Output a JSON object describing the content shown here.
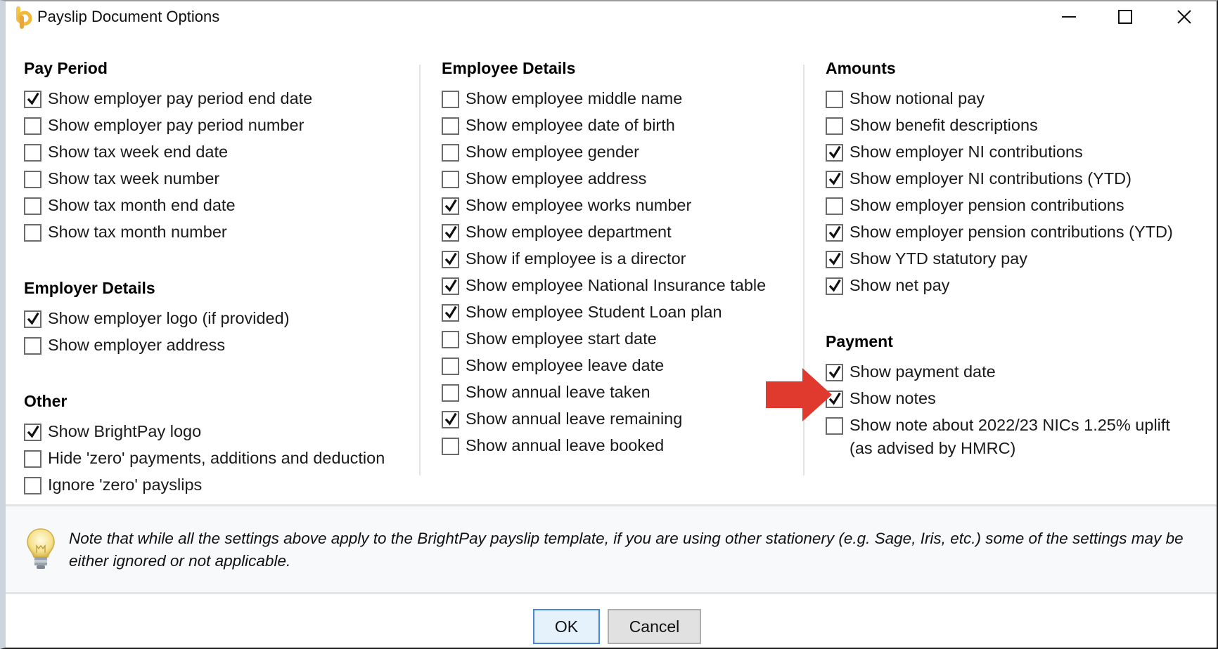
{
  "window": {
    "title": "Payslip Document Options",
    "icons": {
      "app": "brightpay-logo-icon",
      "minimize": "minimize-icon",
      "maximize": "maximize-icon",
      "close": "close-icon"
    }
  },
  "columns": [
    {
      "groups": [
        {
          "heading": "Pay Period",
          "options": [
            {
              "label": "Show employer pay period end date",
              "checked": true
            },
            {
              "label": "Show employer pay period number",
              "checked": false
            },
            {
              "label": "Show tax week end date",
              "checked": false
            },
            {
              "label": "Show tax week number",
              "checked": false
            },
            {
              "label": "Show tax month end date",
              "checked": false
            },
            {
              "label": "Show tax month number",
              "checked": false
            }
          ]
        },
        {
          "heading": "Employer Details",
          "options": [
            {
              "label": "Show employer logo (if provided)",
              "checked": true
            },
            {
              "label": "Show employer address",
              "checked": false
            }
          ]
        },
        {
          "heading": "Other",
          "options": [
            {
              "label": "Show BrightPay logo",
              "checked": true
            },
            {
              "label": "Hide 'zero' payments, additions and deduction",
              "checked": false
            },
            {
              "label": "Ignore 'zero' payslips",
              "checked": false
            }
          ]
        }
      ]
    },
    {
      "groups": [
        {
          "heading": "Employee Details",
          "options": [
            {
              "label": "Show employee middle name",
              "checked": false
            },
            {
              "label": "Show employee date of birth",
              "checked": false
            },
            {
              "label": "Show employee gender",
              "checked": false
            },
            {
              "label": "Show employee address",
              "checked": false
            },
            {
              "label": "Show employee works number",
              "checked": true
            },
            {
              "label": "Show employee department",
              "checked": true
            },
            {
              "label": "Show if employee is a director",
              "checked": true
            },
            {
              "label": "Show employee National Insurance table",
              "checked": true
            },
            {
              "label": "Show employee Student Loan plan",
              "checked": true
            },
            {
              "label": "Show employee start date",
              "checked": false
            },
            {
              "label": "Show employee leave date",
              "checked": false
            },
            {
              "label": "Show annual leave taken",
              "checked": false
            },
            {
              "label": "Show annual leave remaining",
              "checked": true
            },
            {
              "label": "Show annual leave booked",
              "checked": false
            }
          ]
        }
      ]
    },
    {
      "groups": [
        {
          "heading": "Amounts",
          "options": [
            {
              "label": "Show notional pay",
              "checked": false
            },
            {
              "label": "Show benefit descriptions",
              "checked": false
            },
            {
              "label": "Show employer NI contributions",
              "checked": true
            },
            {
              "label": "Show employer NI contributions (YTD)",
              "checked": true
            },
            {
              "label": "Show employer pension contributions",
              "checked": false
            },
            {
              "label": "Show employer pension contributions (YTD)",
              "checked": true
            },
            {
              "label": "Show YTD statutory pay",
              "checked": true
            },
            {
              "label": "Show net pay",
              "checked": true
            }
          ]
        },
        {
          "heading": "Payment",
          "options": [
            {
              "label": "Show payment date",
              "checked": true
            },
            {
              "label": "Show notes",
              "checked": true,
              "highlighted": true
            },
            {
              "label": "Show note about 2022/23 NICs 1.25% uplift",
              "label_line2": "(as advised by HMRC)",
              "checked": false
            }
          ]
        }
      ]
    }
  ],
  "note": {
    "icon": "lightbulb-icon",
    "text": "Note that while all the settings above apply to the BrightPay payslip template, if you are using other stationery (e.g. Sage, Iris, etc.) some of the settings may be either ignored or not applicable."
  },
  "buttons": {
    "ok": "OK",
    "cancel": "Cancel"
  },
  "annotation": {
    "icon": "red-arrow-icon",
    "color": "#e03a2e"
  },
  "colors": {
    "accent": "#4a86d8",
    "logo": "#f0b93a",
    "arrow": "#e03a2e"
  }
}
